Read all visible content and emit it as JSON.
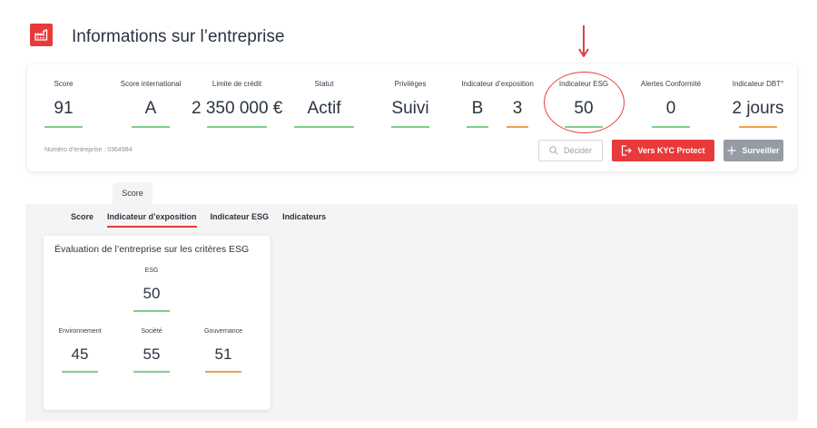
{
  "header": {
    "title": "Informations sur l’entreprise",
    "logo_icon": "factory-icon",
    "accent_color": "#e83a3a"
  },
  "metrics": {
    "score": {
      "label": "Score",
      "value": "91"
    },
    "international": {
      "label": "Score international",
      "value": "A"
    },
    "credit": {
      "label": "Limite de crédit",
      "value": "2 350 000 €"
    },
    "statut": {
      "label": "Statut",
      "value": "Actif"
    },
    "privileges": {
      "label": "Privilèges",
      "value": "Suivi"
    },
    "exposition": {
      "label": "Indicateur d’exposition",
      "value_a": "B",
      "value_b": "3"
    },
    "esg": {
      "label": "Indicateur ESG",
      "value": "50"
    },
    "alertes": {
      "label": "Alertes Conformité",
      "value": "0"
    },
    "dbt": {
      "label": "Indicateur DBT°",
      "value": "2 jours"
    }
  },
  "company_number": "Numéro d’entreprise : 0364984",
  "actions": {
    "decider": "Décider",
    "kyc": "Vers KYC Protect",
    "surveiller": "Surveiller"
  },
  "section_tab": "Score",
  "tabs": [
    {
      "label": "Score"
    },
    {
      "label": "Indicateur d’exposition"
    },
    {
      "label": "Indicateur ESG"
    },
    {
      "label": "Indicateurs"
    }
  ],
  "esg_card": {
    "title": "Évaluation de l’entreprise sur les critères ESG",
    "esg": {
      "label": "ESG",
      "value": "50"
    },
    "environnement": {
      "label": "Environnement",
      "value": "45"
    },
    "societe": {
      "label": "Société",
      "value": "55"
    },
    "gouvernance": {
      "label": "Gouvernance",
      "value": "51"
    }
  },
  "colors": {
    "good": "#7fcf8a",
    "warn": "#f1a148",
    "annotation": "#e14040"
  }
}
